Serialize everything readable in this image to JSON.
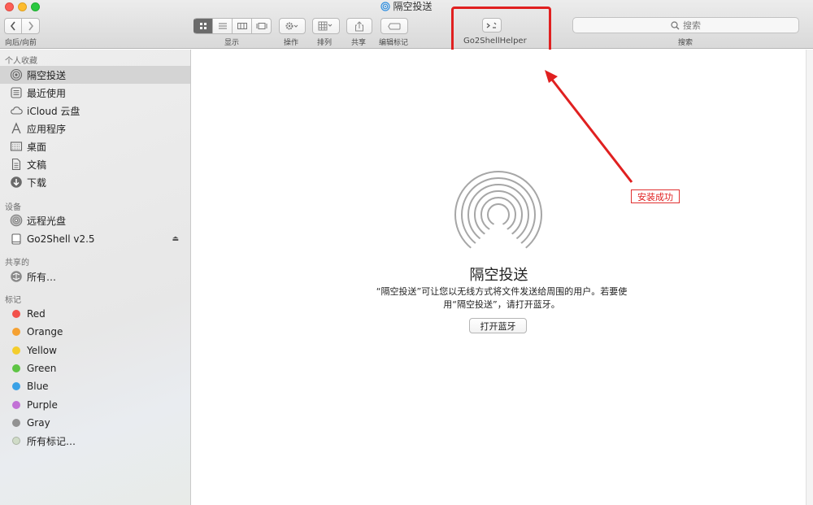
{
  "window": {
    "title": "隔空投送"
  },
  "toolbar": {
    "nav_label": "向后/向前",
    "view_label": "显示",
    "action_label": "操作",
    "arrange_label": "排列",
    "share_label": "共享",
    "tags_label": "编辑标记",
    "go2shell_label": "Go2ShellHelper",
    "search_placeholder": "搜索",
    "search_label": "搜索"
  },
  "sidebar": {
    "favorites_header": "个人收藏",
    "favorites": [
      {
        "label": "隔空投送",
        "icon": "airdrop-icon",
        "selected": true
      },
      {
        "label": "最近使用",
        "icon": "recents-icon"
      },
      {
        "label": "iCloud 云盘",
        "icon": "cloud-icon"
      },
      {
        "label": "应用程序",
        "icon": "applications-icon"
      },
      {
        "label": "桌面",
        "icon": "desktop-icon"
      },
      {
        "label": "文稿",
        "icon": "documents-icon"
      },
      {
        "label": "下载",
        "icon": "downloads-icon"
      }
    ],
    "devices_header": "设备",
    "devices": [
      {
        "label": "远程光盘",
        "icon": "disc-icon"
      },
      {
        "label": "Go2Shell v2.5",
        "icon": "drive-icon"
      }
    ],
    "shared_header": "共享的",
    "shared": [
      {
        "label": "所有…",
        "icon": "network-icon"
      }
    ],
    "tags_header": "标记",
    "tags": [
      {
        "label": "Red",
        "color": "#f2514a"
      },
      {
        "label": "Orange",
        "color": "#f5a132"
      },
      {
        "label": "Yellow",
        "color": "#f4cd2c"
      },
      {
        "label": "Green",
        "color": "#5ec444"
      },
      {
        "label": "Blue",
        "color": "#3aa1e6"
      },
      {
        "label": "Purple",
        "color": "#c271d6"
      },
      {
        "label": "Gray",
        "color": "#929292"
      },
      {
        "label": "所有标记…",
        "color": "#d0dcc8"
      }
    ]
  },
  "main": {
    "title": "隔空投送",
    "description": "“隔空投送”可让您以无线方式将文件发送给周围的用户。若要使用“隔空投送”，请打开蓝牙。",
    "button_label": "打开蓝牙"
  },
  "annotation": {
    "text": "安装成功",
    "color": "#e02020"
  }
}
